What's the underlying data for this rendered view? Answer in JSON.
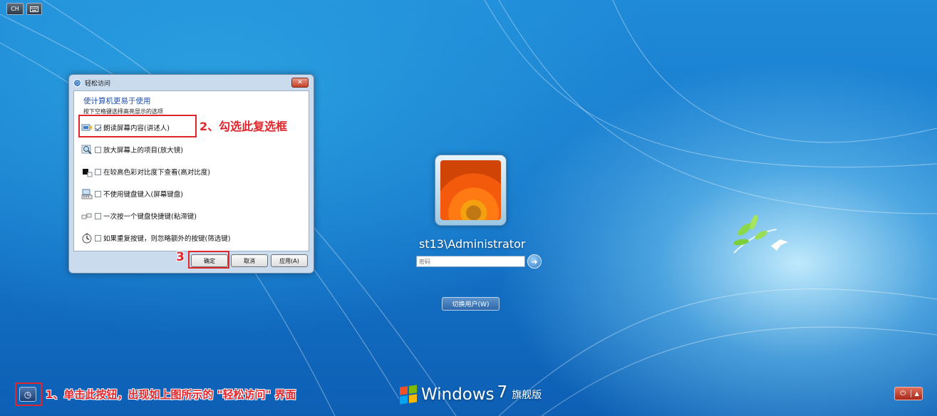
{
  "tray": {
    "lang": "CH",
    "kbd_icon": "keyboard-icon"
  },
  "dialog": {
    "title": "轻松访问",
    "heading": "使计算机更易于使用",
    "instruction": "按下空格键选择高亮显示的选项",
    "options": [
      {
        "label": "朗读屏幕内容(讲述人)",
        "checked": true,
        "icon": "narrator-icon"
      },
      {
        "label": "放大屏幕上的项目(放大镜)",
        "checked": false,
        "icon": "magnifier-icon"
      },
      {
        "label": "在较高色彩对比度下查看(高对比度)",
        "checked": false,
        "icon": "high-contrast-icon"
      },
      {
        "label": "不使用键盘键入(屏幕键盘)",
        "checked": false,
        "icon": "onscreen-keyboard-icon"
      },
      {
        "label": "一次按一个键盘快捷键(粘滞键)",
        "checked": false,
        "icon": "sticky-keys-icon"
      },
      {
        "label": "如果重复按键，则忽略额外的按键(筛选键)",
        "checked": false,
        "icon": "filter-keys-icon"
      }
    ],
    "buttons": {
      "ok": "确定",
      "cancel": "取消",
      "apply": "应用(A)"
    }
  },
  "annotations": {
    "step1": "1、单击此按钮，出现如上图所示的 \"轻松访问\" 界面",
    "step2": "2、勾选此复选框",
    "step3": "3"
  },
  "login": {
    "username": "st13\\Administrator",
    "password_placeholder": "密码",
    "switch_user": "切换用户(W)"
  },
  "brand": {
    "name": "Windows",
    "version": "7",
    "edition": "旗舰版"
  },
  "colors": {
    "annotation": "#e1262b",
    "heading": "#1e4ea8",
    "desktop": "#1574c8"
  }
}
